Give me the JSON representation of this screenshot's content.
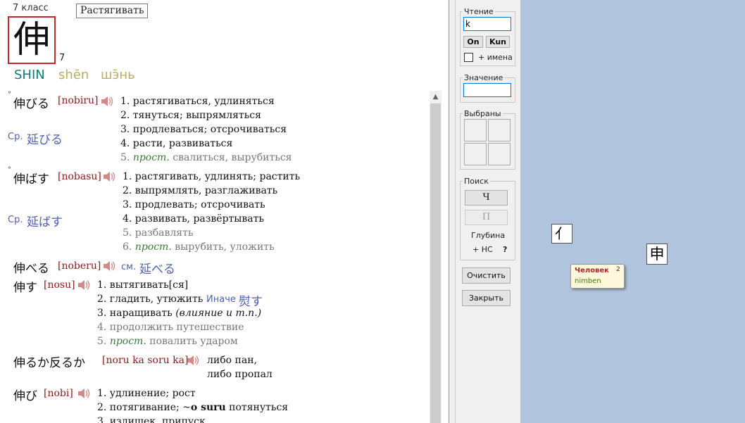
{
  "header": {
    "grade": "7 класс",
    "tooltip": "Растягивать",
    "kanji": "伸",
    "strokes": "7",
    "on_reading": "SHIN",
    "pinyin": "shēn",
    "zhuyin": "шэ̄нь"
  },
  "entries": {
    "e1": {
      "mark": "°",
      "word": "伸びる",
      "romaji": "[nobiru]",
      "cross_label": "Ср.",
      "cross_word": "延びる",
      "senses": [
        "1. растягиваться, удлиняться",
        "2. тянуться; выпрямляться",
        "3. продлеваться; отсрочиваться",
        "4. расти, развиваться"
      ],
      "sense5_num": "5.",
      "sense5_tag": "прост.",
      "sense5_text": "свалиться, вырубиться"
    },
    "e2": {
      "mark": "°",
      "word": "伸ばす",
      "romaji": "[nobasu]",
      "cross_label": "Ср.",
      "cross_word": "延ばす",
      "senses": [
        "1. растягивать, удлинять; растить",
        "2. выпрямлять, разглаживать",
        "3. продлевать; отсрочивать",
        "4. развивать, развёртывать"
      ],
      "sense5": "5. разбавлять",
      "sense6_num": "6.",
      "sense6_tag": "прост.",
      "sense6_text": "вырубить, уложить"
    },
    "e3": {
      "word": "伸べる",
      "romaji": "[noberu]",
      "see_label": "см.",
      "see_word": "延べる"
    },
    "e4": {
      "word": "伸す",
      "romaji": "[nosu]",
      "senses": [
        "1. вытягивать[ся]",
        "2. гладить, утюжить"
      ],
      "alt_label": "Иначе",
      "alt_word": "熨す",
      "sense3_text": "3. наращивать",
      "sense3_note": "(влияние и т.п.)",
      "sense4": "4. продолжить путешествие",
      "sense5_num": "5.",
      "sense5_tag": "прост.",
      "sense5_text": "повалить ударом"
    },
    "e5": {
      "word": "伸るか反るか",
      "romaji": "[noru ka soru ka]",
      "senses": [
        "либо пан,",
        "либо пропал"
      ]
    },
    "e6": {
      "word": "伸び",
      "romaji": "[nobi]",
      "sense1": "1. удлинение; рост",
      "sense2_pre": "2. потягивание; ~",
      "sense2_jp": "o suru",
      "sense2_post": "потянуться",
      "sense3": "3. излишек, припуск"
    }
  },
  "side": {
    "reading_legend": "Чтение",
    "reading_value": "k",
    "on_btn": "On",
    "kun_btn": "Kun",
    "names_label": "+ имена",
    "meaning_legend": "Значение",
    "meaning_value": "",
    "selected_legend": "Выбраны",
    "search_legend": "Поиск",
    "btn_ch": "Ч",
    "btn_p": "П",
    "depth_label": "Глубина",
    "hc_label": "+ НС",
    "help_label": "?",
    "clear_btn": "Очистить",
    "close_btn": "Закрыть"
  },
  "desk": {
    "radical1": "亻",
    "radical2": "申",
    "card_title": "Человек",
    "card_count": "2",
    "card_sub": "nimben"
  },
  "colors": {
    "kanji_border": "#c1272d",
    "on_reading": "#0f7b7b",
    "pinyin": "#b9ad62",
    "romaji": "#8b1a1a",
    "desk_bg": "#b0c4de"
  }
}
